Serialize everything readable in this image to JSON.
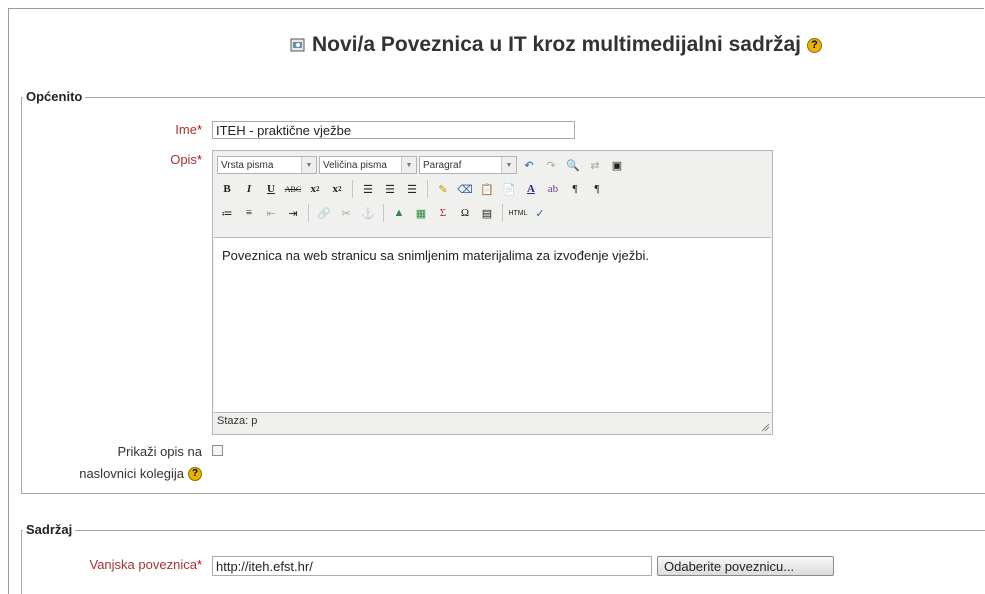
{
  "header": {
    "title": "Novi/a Poveznica u IT kroz multimedijalni sadržaj",
    "module_icon": "url-module-icon",
    "help_icon": "help-icon"
  },
  "general": {
    "legend": "Općenito",
    "name_label": "Ime",
    "name_value": "ITEH - praktične vježbe",
    "description_label": "Opis",
    "editor": {
      "font_family_select": "Vrsta pisma",
      "font_size_select": "Veličina pisma",
      "format_select": "Paragraf",
      "content": "Poveznica na web stranicu sa snimljenim materijalima za izvođenje vježbi.",
      "status": "Staza: p"
    },
    "show_description_label_line1": "Prikaži opis na",
    "show_description_label_line2": "naslovnici kolegija",
    "show_description_checked": false
  },
  "content": {
    "legend": "Sadržaj",
    "external_url_label": "Vanjska poveznica",
    "external_url_value": "http://iteh.efst.hr/",
    "choose_link_button": "Odaberite poveznicu..."
  },
  "required_marker": "*"
}
